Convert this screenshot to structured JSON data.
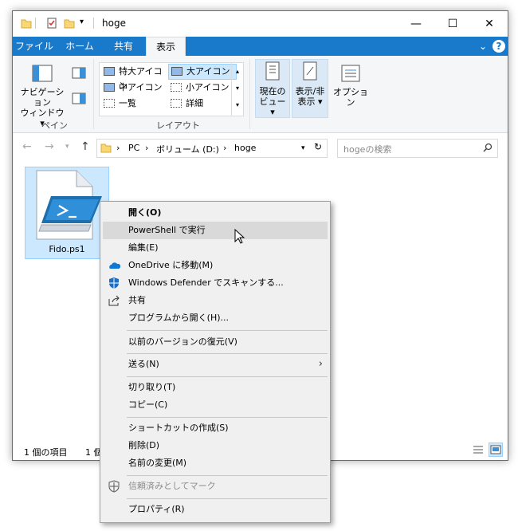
{
  "window": {
    "title": "hoge",
    "caption_buttons": {
      "minimize": "—",
      "maximize": "☐",
      "close": "✕"
    }
  },
  "ribbon_tabs": [
    {
      "label": "ファイル"
    },
    {
      "label": "ホーム"
    },
    {
      "label": "共有"
    },
    {
      "label": "表示"
    }
  ],
  "ribbon": {
    "pane_group": {
      "nav_pane_label_1": "ナビゲーション",
      "nav_pane_label_2": "ウィンドウ ▾",
      "group_label": "ペイン"
    },
    "layout_group": {
      "items": [
        {
          "label": "特大アイコン"
        },
        {
          "label": "大アイコン"
        },
        {
          "label": "中アイコン"
        },
        {
          "label": "小アイコン"
        },
        {
          "label": "一覧"
        },
        {
          "label": "詳細"
        }
      ],
      "group_label": "レイアウト"
    },
    "current_view": {
      "line1": "現在の",
      "line2": "ビュー ▾"
    },
    "show_hide": {
      "line1": "表示/非",
      "line2": "表示 ▾"
    },
    "options": {
      "label": "オプション"
    }
  },
  "address": {
    "breadcrumbs": [
      "PC",
      "ボリューム (D:)",
      "hoge"
    ],
    "search_placeholder": "hogeの検索"
  },
  "file": {
    "name": "Fido.ps1"
  },
  "status": {
    "item_count": "1 個の項目",
    "selected": "1 個"
  },
  "context_menu": {
    "items": [
      {
        "label": "開く(O)"
      },
      {
        "label": "PowerShell で実行"
      },
      {
        "label": "編集(E)"
      },
      {
        "label": "OneDrive に移動(M)"
      },
      {
        "label": "Windows Defender でスキャンする..."
      },
      {
        "label": "共有"
      },
      {
        "label": "プログラムから開く(H)..."
      },
      {
        "label": "以前のバージョンの復元(V)"
      },
      {
        "label": "送る(N)"
      },
      {
        "label": "切り取り(T)"
      },
      {
        "label": "コピー(C)"
      },
      {
        "label": "ショートカットの作成(S)"
      },
      {
        "label": "削除(D)"
      },
      {
        "label": "名前の変更(M)"
      },
      {
        "label": "信頼済みとしてマーク"
      },
      {
        "label": "プロパティ(R)"
      }
    ]
  },
  "colors": {
    "accent": "#1979ca",
    "selection": "#cce8ff",
    "menu_bg": "#f0f0f0"
  }
}
